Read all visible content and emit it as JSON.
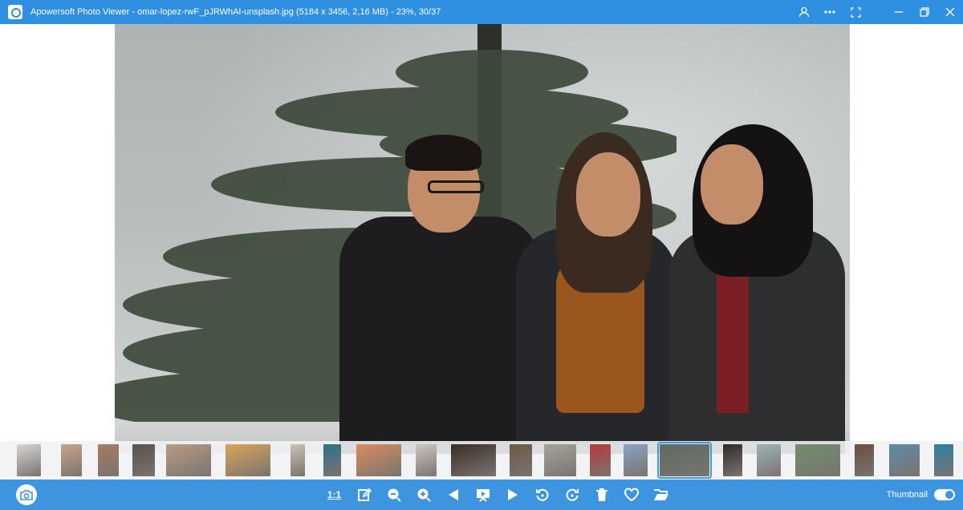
{
  "window": {
    "title": "Apowersoft Photo Viewer - omar-lopez-rwF_pJRWhAI-unsplash.jpg (5184 x 3456, 2,16 MB) - 23%, 30/37",
    "icons": [
      "account-icon",
      "more-icon",
      "fullscreen-icon",
      "minimize-icon",
      "restore-icon",
      "close-icon"
    ]
  },
  "thumbnails": [
    {
      "w": 30,
      "color": "#d8d6d3"
    },
    {
      "w": 26,
      "color": "#c9a58c"
    },
    {
      "w": 26,
      "color": "#a77b63"
    },
    {
      "w": 28,
      "color": "#5a5248"
    },
    {
      "w": 56,
      "color": "#b79c84"
    },
    {
      "w": 56,
      "color": "#d9a55a"
    },
    {
      "w": 18,
      "color": "#c9c2b4"
    },
    {
      "w": 22,
      "color": "#2f6f8a"
    },
    {
      "w": 56,
      "color": "#d98c5e"
    },
    {
      "w": 26,
      "color": "#cfc8c0"
    },
    {
      "w": 56,
      "color": "#3a2e26"
    },
    {
      "w": 28,
      "color": "#6b5a45"
    },
    {
      "w": 40,
      "color": "#a7a29c"
    },
    {
      "w": 26,
      "color": "#b53a38"
    },
    {
      "w": 30,
      "color": "#8aa4c4"
    },
    {
      "w": 62,
      "color": "#5d6a63",
      "selected": true
    },
    {
      "w": 24,
      "color": "#2d2a28"
    },
    {
      "w": 30,
      "color": "#9db3b8"
    },
    {
      "w": 56,
      "color": "#6f8f6c"
    },
    {
      "w": 24,
      "color": "#6b4e3e"
    },
    {
      "w": 38,
      "color": "#5e8aa8"
    },
    {
      "w": 24,
      "color": "#2c7fa6"
    }
  ],
  "toolbar": {
    "actual_size_label": "1:1",
    "thumbnail_label": "Thumbnail",
    "thumbnail_toggle_on": true,
    "tools": [
      "edit-icon",
      "zoom-out-icon",
      "zoom-in-icon",
      "previous-icon",
      "slideshow-icon",
      "next-icon",
      "rotate-left-icon",
      "rotate-right-icon",
      "delete-icon",
      "favorite-icon",
      "open-folder-icon"
    ]
  },
  "colors": {
    "titlebar": "#2f8fe0",
    "toolbar": "#3d95e0",
    "accent": "#3b9bea"
  }
}
